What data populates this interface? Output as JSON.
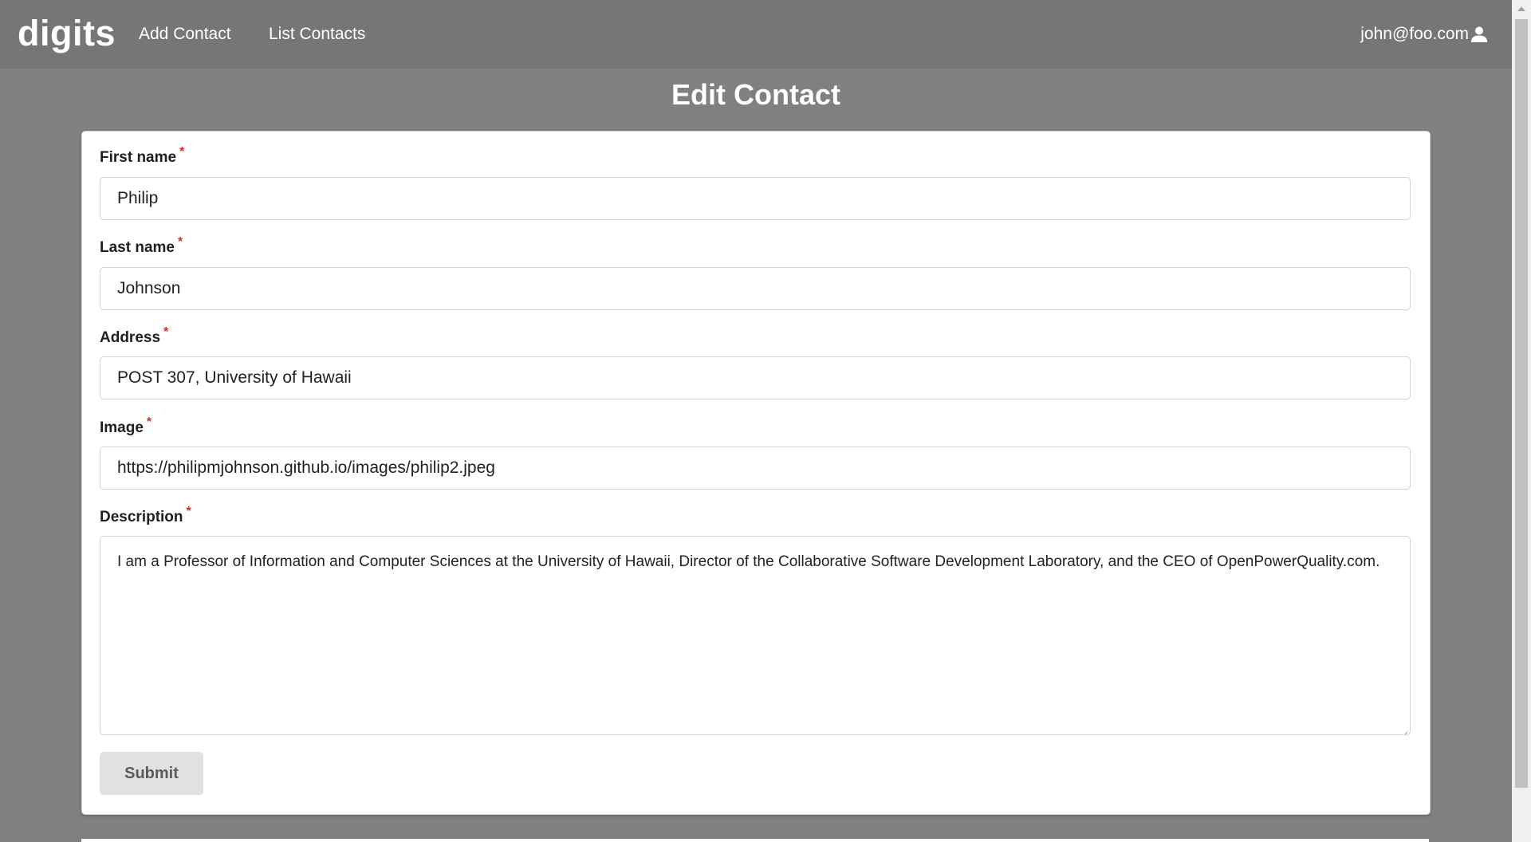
{
  "navbar": {
    "brand": "digits",
    "links": [
      "Add Contact",
      "List Contacts"
    ],
    "user": "john@foo.com"
  },
  "page_title": "Edit Contact",
  "form": {
    "required_marker": "*",
    "first_name": {
      "label": "First name",
      "value": "Philip"
    },
    "last_name": {
      "label": "Last name",
      "value": "Johnson"
    },
    "address": {
      "label": "Address",
      "value": "POST 307, University of Hawaii"
    },
    "image": {
      "label": "Image",
      "value": "https://philipmjohnson.github.io/images/philip2.jpeg"
    },
    "description": {
      "label": "Description",
      "value": "I am a Professor of Information and Computer Sciences at the University of Hawaii, Director of the Collaborative Software Development Laboratory, and the CEO of OpenPowerQuality.com."
    },
    "submit_label": "Submit"
  },
  "icons": {
    "user": "user-icon"
  },
  "colors": {
    "background": "#808080",
    "navbar": "#767676",
    "required": "#db2828",
    "button": "#e0e1e2"
  }
}
